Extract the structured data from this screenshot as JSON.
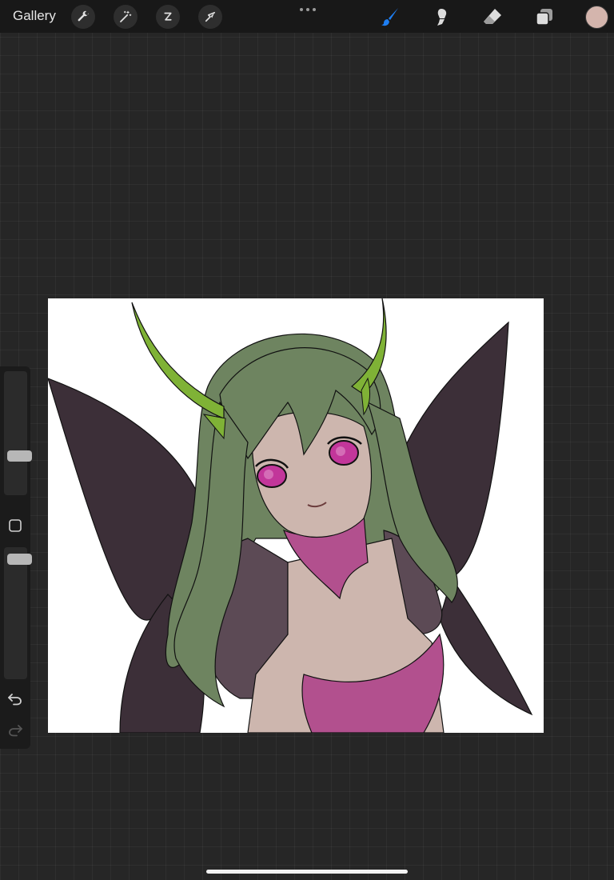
{
  "topbar": {
    "gallery_label": "Gallery",
    "left_tools": [
      {
        "name": "actions",
        "icon": "wrench-icon"
      },
      {
        "name": "adjustments",
        "icon": "magic-wand-icon"
      },
      {
        "name": "selection",
        "icon": "selection-s-icon"
      },
      {
        "name": "transform",
        "icon": "arrow-cursor-icon"
      }
    ],
    "more_icon": "ellipsis-icon",
    "right_tools": [
      {
        "name": "brush",
        "icon": "brush-icon",
        "active": true
      },
      {
        "name": "smudge",
        "icon": "smudge-icon",
        "active": false
      },
      {
        "name": "eraser",
        "icon": "eraser-icon",
        "active": false
      },
      {
        "name": "layers",
        "icon": "layers-icon",
        "active": false
      }
    ],
    "current_color": "#d4b5ad",
    "active_tool_color": "#1e7ef2"
  },
  "sidebar": {
    "brush_size_level": 0.3,
    "opacity_level": 0.95,
    "modify_icon": "square-icon",
    "undo_icon": "undo-arrow-icon",
    "redo_icon": "redo-arrow-icon"
  },
  "artwork": {
    "description_colors": {
      "hair": "#6e8460",
      "horns": "#7fb236",
      "wings": "#3c2f38",
      "skin": "#cdb6ae",
      "eyes": "#c2369a",
      "collar": "#b2508e",
      "sleeves": "#5c4a55"
    }
  }
}
